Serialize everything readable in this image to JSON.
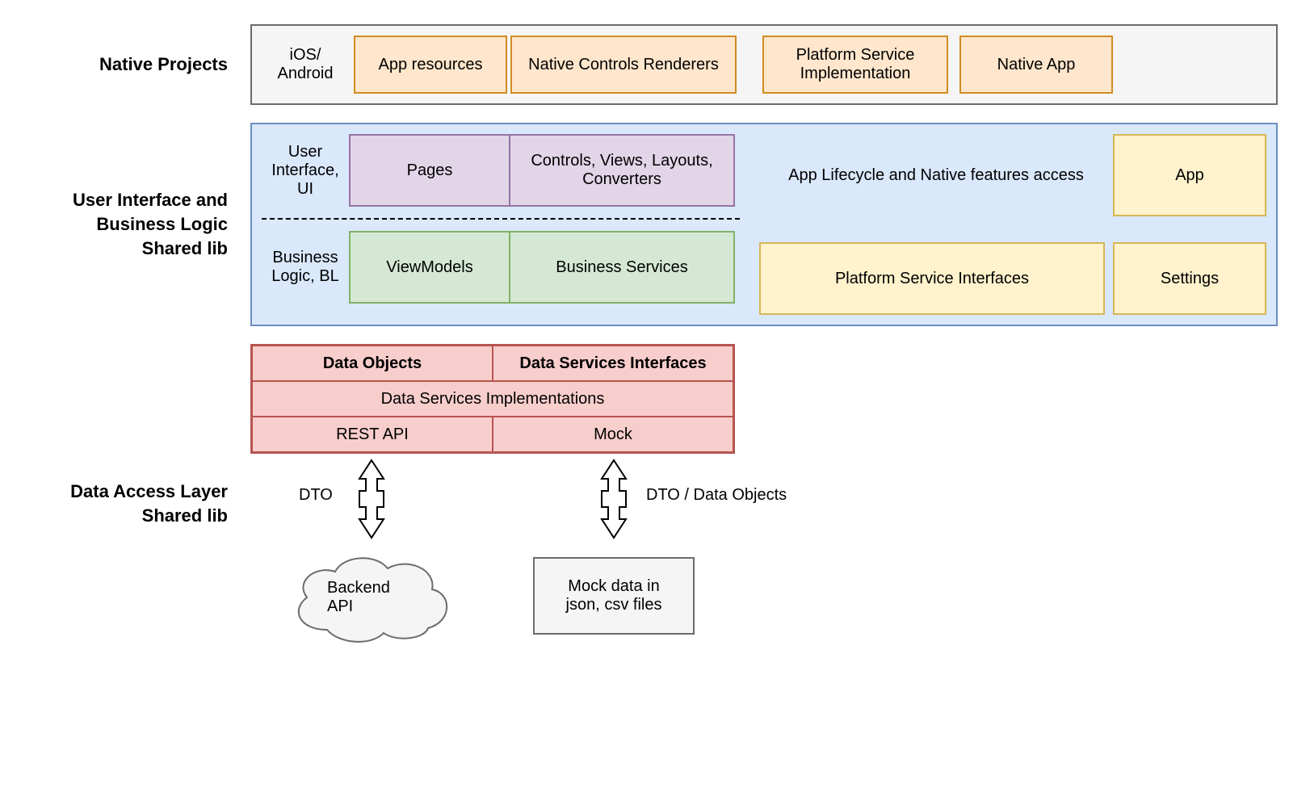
{
  "labels": {
    "native": "Native Projects",
    "shared": "User Interface and Business Logic Shared lib",
    "dal": "Data Access Layer Shared lib"
  },
  "native": {
    "left": "iOS/ Android",
    "b1": "App resources",
    "b2": "Native Controls Renderers",
    "b3": "Platform Service Implementation",
    "b4": "Native App"
  },
  "shared": {
    "ui_label": "User Interface, UI",
    "ui_b1": "Pages",
    "ui_b2": "Controls, Views, Layouts, Converters",
    "bl_label": "Business Logic, BL",
    "bl_b1": "ViewModels",
    "bl_b2": "Business Services",
    "right_label": "App Lifecycle and Native features access",
    "right_b1": "App",
    "right_b2": "Platform Service Interfaces",
    "right_b3": "Settings"
  },
  "dal": {
    "h1": "Data Objects",
    "h2": "Data Services Interfaces",
    "impl": "Data Services Implementations",
    "rest": "REST API",
    "mock": "Mock"
  },
  "bottom": {
    "dto_left": "DTO",
    "dto_right": "DTO / Data Objects",
    "cloud": "Backend API",
    "mockbox": "Mock data in json, csv files"
  }
}
